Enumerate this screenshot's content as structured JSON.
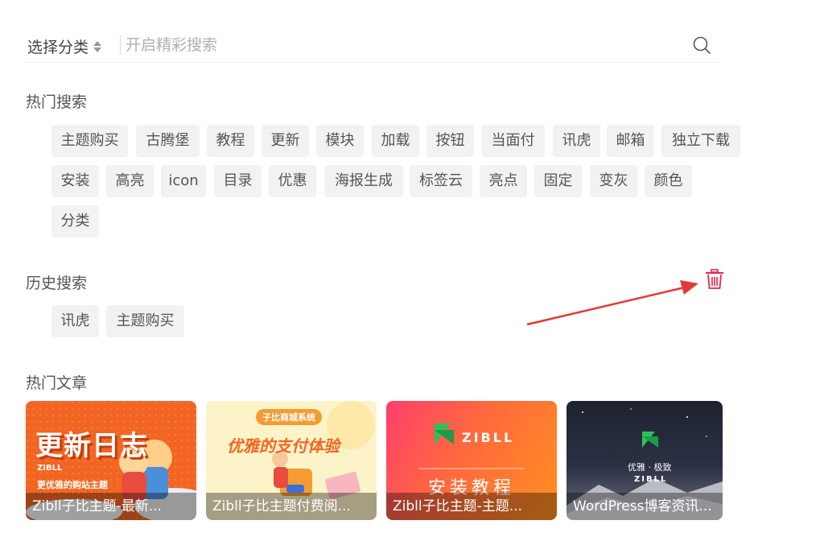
{
  "search": {
    "category_label": "选择分类",
    "placeholder": "开启精彩搜索"
  },
  "hot_search": {
    "title": "热门搜索",
    "tags": [
      "主题购买",
      "古腾堡",
      "教程",
      "更新",
      "模块",
      "加载",
      "按钮",
      "当面付",
      "讯虎",
      "邮箱",
      "独立下载",
      "安装",
      "高亮",
      "icon",
      "目录",
      "优惠",
      "海报生成",
      "标签云",
      "亮点",
      "固定",
      "变灰",
      "颜色",
      "分类"
    ]
  },
  "history_search": {
    "title": "历史搜索",
    "tags": [
      "讯虎",
      "主题购买"
    ]
  },
  "hot_articles": {
    "title": "热门文章",
    "items": [
      {
        "caption": "Zibll子比主题-最新...",
        "art_title": "更新日志",
        "art_sub": "更优雅的购站主题",
        "art_brand": "ZIBLL"
      },
      {
        "caption": "Zibll子比主题付费阅...",
        "art_badge": "子比商城系统",
        "art_title": "优雅的支付体验"
      },
      {
        "caption": "Zibll子比主题-主题...",
        "art_brand": "ZIBLL",
        "art_title": "安装教程"
      },
      {
        "caption": "WordPress博客资讯...",
        "art_sub": "优雅 · 极致",
        "art_brand": "ZIBLL"
      }
    ]
  },
  "colors": {
    "accent_red": "#e0284f",
    "tag_bg": "#f1f2f3",
    "arrow_red": "#e53935"
  },
  "icons": {
    "search": "search-icon",
    "trash": "trash-icon",
    "sort": "sort-arrows-icon"
  }
}
